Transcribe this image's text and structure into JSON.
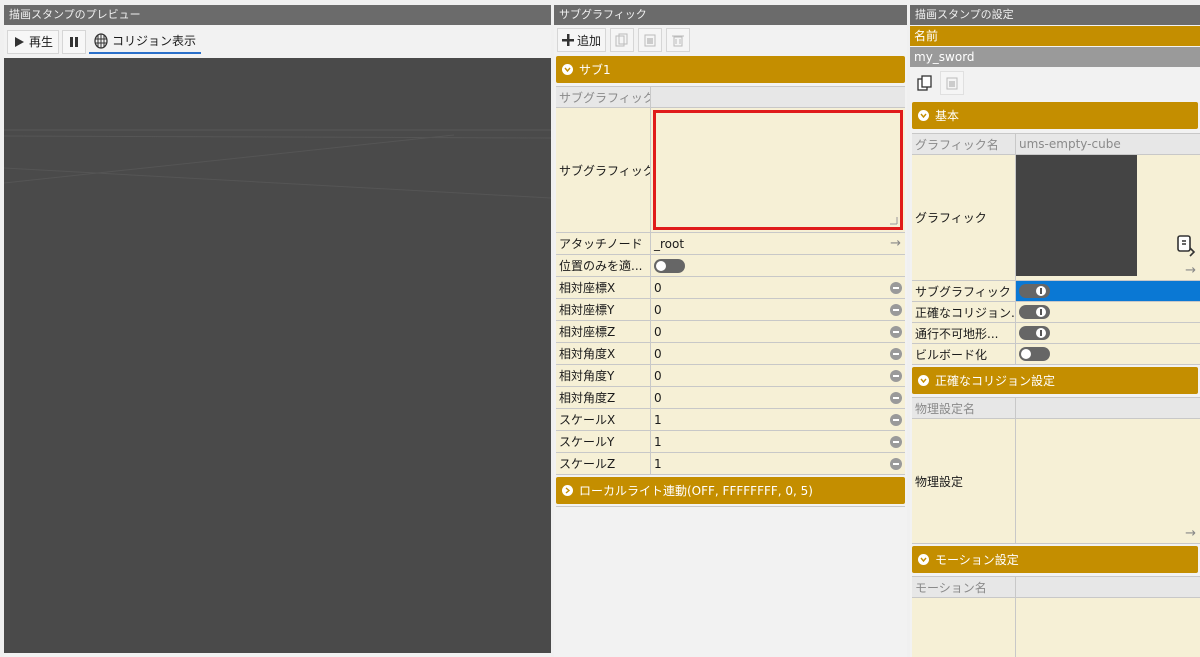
{
  "left_panel": {
    "title": "描画スタンプのプレビュー",
    "play_label": "再生",
    "collision_label": "コリジョン表示"
  },
  "mid_panel": {
    "title": "サブグラフィック",
    "add_label": "追加",
    "section_title": "サブ1",
    "rows": {
      "subgraphic_name_key": "サブグラフィック名",
      "subgraphic_key": "サブグラフィック",
      "attach_node_key": "アタッチノード",
      "attach_node_value": "_root",
      "position_only_key": "位置のみを適...",
      "props": [
        {
          "key": "相対座標X",
          "value": "0"
        },
        {
          "key": "相対座標Y",
          "value": "0"
        },
        {
          "key": "相対座標Z",
          "value": "0"
        },
        {
          "key": "相対角度X",
          "value": "0"
        },
        {
          "key": "相対角度Y",
          "value": "0"
        },
        {
          "key": "相対角度Z",
          "value": "0"
        },
        {
          "key": "スケールX",
          "value": "1"
        },
        {
          "key": "スケールY",
          "value": "1"
        },
        {
          "key": "スケールZ",
          "value": "1"
        }
      ]
    },
    "local_light": "ローカルライト連動(OFF, FFFFFFFF, 0, 5)"
  },
  "right_panel": {
    "title": "描画スタンプの設定",
    "name_label": "名前",
    "name_value": "my_sword",
    "basic_section": "基本",
    "graphic_name_key": "グラフィック名",
    "graphic_name_value": "ums-empty-cube",
    "graphic_key": "グラフィック",
    "toggles": [
      {
        "key": "サブグラフィック",
        "on": true
      },
      {
        "key": "正確なコリジョン...",
        "on": true
      },
      {
        "key": "通行不可地形...",
        "on": true
      },
      {
        "key": "ビルボード化",
        "on": false
      }
    ],
    "collision_section": "正確なコリジョン設定",
    "physics_name_key": "物理設定名",
    "physics_key": "物理設定",
    "motion_section": "モーション設定",
    "motion_name_key": "モーション名"
  },
  "colors": {
    "accent_gold": "#c48e00",
    "selection_blue": "#0a78d4",
    "highlight_red": "#e01b1b",
    "viewport": "#4a4a4a",
    "row_bg": "#f6f0d6"
  }
}
